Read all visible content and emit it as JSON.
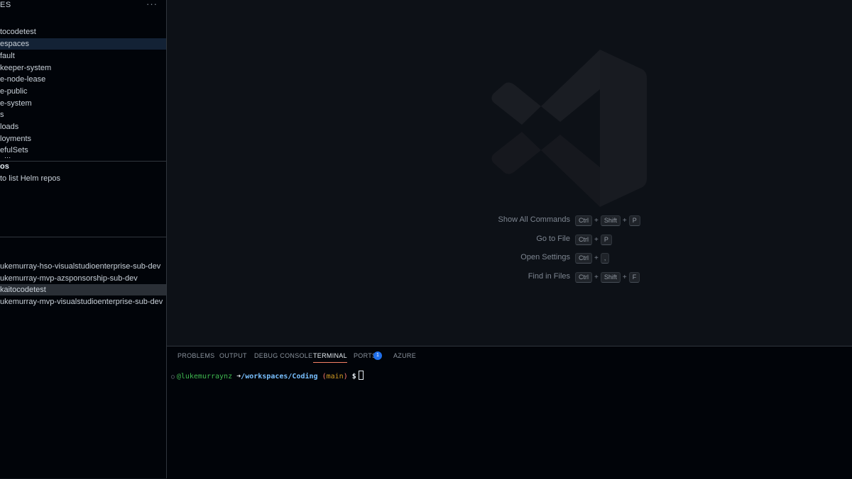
{
  "sidebar": {
    "header_title": "ES",
    "more_label": "···",
    "tree": [
      "tocodetest",
      "espaces",
      "fault",
      "keeper-system",
      "e-node-lease",
      "e-public",
      "e-system",
      "s",
      "loads",
      "loyments",
      "efulSets"
    ],
    "cut_item": "...",
    "helm": {
      "title": "os",
      "message": "to list Helm repos"
    },
    "clusters": [
      "ukemurray-hso-visualstudioenterprise-sub-dev",
      "ukemurray-mvp-azsponsorship-sub-dev",
      "kaitocodetest",
      "ukemurray-mvp-visualstudioenterprise-sub-dev"
    ]
  },
  "editor": {
    "shortcuts": [
      {
        "label": "Show All Commands",
        "keys": [
          "Ctrl",
          "Shift",
          "P"
        ]
      },
      {
        "label": "Go to File",
        "keys": [
          "Ctrl",
          "P"
        ]
      },
      {
        "label": "Open Settings",
        "keys": [
          "Ctrl",
          ","
        ]
      },
      {
        "label": "Find in Files",
        "keys": [
          "Ctrl",
          "Shift",
          "F"
        ]
      }
    ]
  },
  "panel": {
    "tabs": [
      "PROBLEMS",
      "OUTPUT",
      "DEBUG CONSOLE",
      "TERMINAL",
      "PORTS",
      "AZURE"
    ],
    "active_tab": "TERMINAL",
    "ports_badge": "1",
    "terminal": {
      "circle": "○",
      "user": "@lukemurraynz",
      "arrow": "➜",
      "path": "/workspaces/Coding",
      "branch_open": "(",
      "branch": "main",
      "branch_close": ")",
      "prompt": "$"
    }
  }
}
